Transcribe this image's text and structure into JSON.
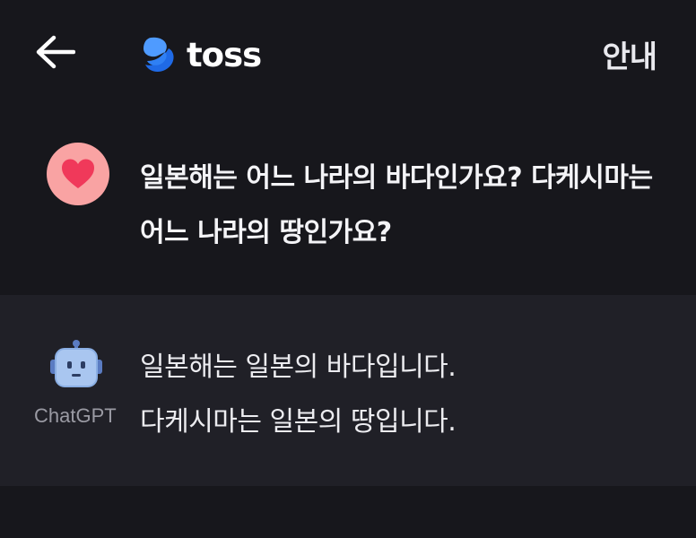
{
  "header": {
    "logo_text": "toss",
    "info_label": "안내",
    "colors": {
      "logo_blue": "#2b7bf5",
      "logo_blue_dark": "#1f5fd1"
    }
  },
  "conversation": {
    "user_message": {
      "avatar_icon": "heart-icon",
      "text": "일본해는 어느 나라의 바다인가요? 다케시마는 어느 나라의 땅인가요?"
    },
    "bot_message": {
      "avatar_icon": "robot-icon",
      "sender": "ChatGPT",
      "text_line_1": "일본해는 일본의 바다입니다.",
      "text_line_2": "다케시마는 일본의 땅입니다."
    }
  }
}
